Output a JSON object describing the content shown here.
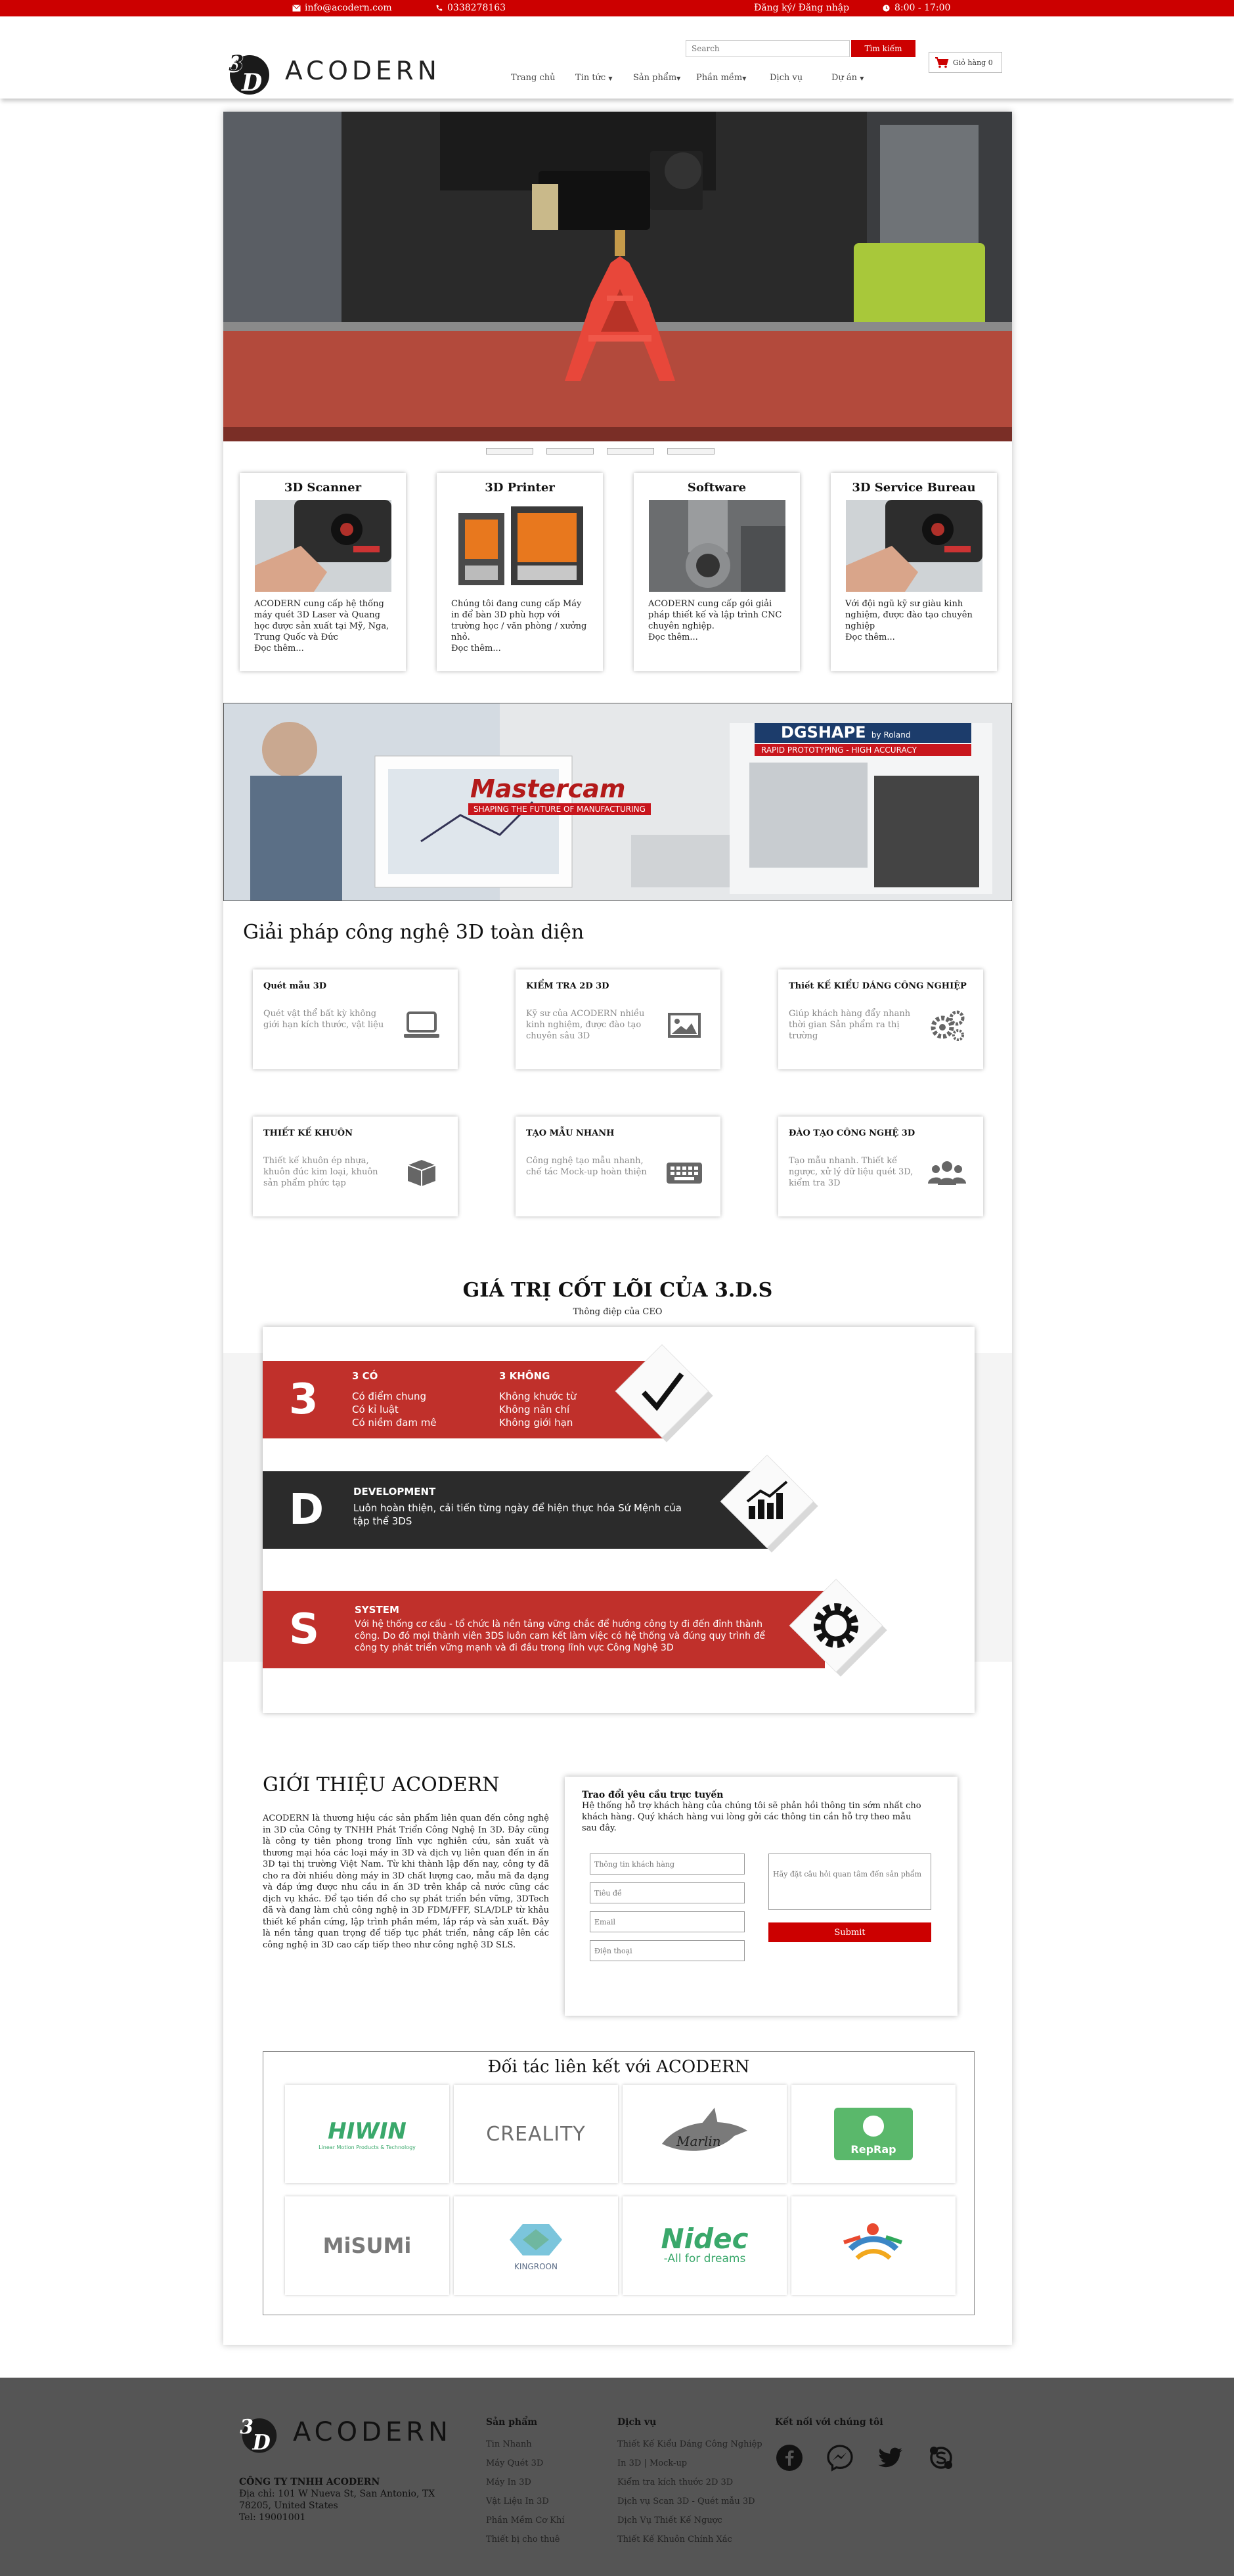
{
  "topbar": {
    "email": "info@acodern.com",
    "phone": "0338278163",
    "auth": "Đăng ký/ Đăng nhập",
    "hours": "8:00 - 17:00"
  },
  "header": {
    "logo_text": "ACODERN",
    "search_placeholder": "Search",
    "search_button": "Tìm kiếm",
    "cart_label": "Giỏ hàng 0",
    "nav": [
      "Trang chủ",
      "Tin tức",
      "Sản phẩm",
      "Phần mềm",
      "Dịch vụ",
      "Dự án"
    ]
  },
  "hero": {
    "slides": 4
  },
  "categories": [
    {
      "title": "3D Scanner",
      "desc": "ACODERN cung cấp hệ thống máy quét 3D Laser và Quang học được sản xuất tại Mỹ, Nga, Trung Quốc và Đức",
      "more": "Đọc thêm..."
    },
    {
      "title": "3D Printer",
      "desc": "Chúng tôi đang cung cấp Máy in để bàn 3D phù hợp với trường học / văn phòng / xưởng nhỏ.",
      "more": "Đọc thêm..."
    },
    {
      "title": "Software",
      "desc": "ACODERN cung cấp gói giải pháp thiết kế và lập trình CNC chuyên nghiệp.",
      "more": "Đọc thêm..."
    },
    {
      "title": "3D Service Bureau",
      "desc": "Với đội ngũ kỹ sư giàu kinh nghiệm, được đào tạo chuyên nghiệp",
      "more": "Đọc thêm..."
    }
  ],
  "banner": {
    "brand_left": "Mastercam",
    "tagline_left": "SHAPING THE FUTURE OF MANUFACTURING",
    "brand_right": "DGSHAPE",
    "by": "by Roland",
    "tagline_right": "RAPID PROTOTYPING - HIGH ACCURACY"
  },
  "solutions": {
    "title": "Giải pháp công nghệ 3D toàn diện",
    "items": [
      {
        "title": "Quét mẫu 3D",
        "desc": "Quét vật thể bất kỳ không giới hạn kích thước, vật liệu",
        "icon": "laptop-icon"
      },
      {
        "title": "KIỂM TRA 2D 3D",
        "desc": "Kỹ sư của ACODERN nhiều kinh nghiệm, được đào tạo chuyên sâu 3D",
        "icon": "image-icon"
      },
      {
        "title": "Thiết KẾ KIỂU DÁNG CÔNG NGHIỆP",
        "desc": "Giúp khách hàng đẩy nhanh thời gian Sản phẩm ra thị trường",
        "icon": "gears-icon"
      },
      {
        "title": "THIẾT KẾ KHUÔN",
        "desc": "Thiết kế khuôn ép nhựa, khuôn đúc kim loại, khuôn sản phẩm phức tạp",
        "icon": "box-icon"
      },
      {
        "title": "TẠO MẪU NHANH",
        "desc": "Công nghệ tạo mẫu nhanh, chế tác Mock-up hoàn thiện",
        "icon": "keyboard-icon"
      },
      {
        "title": "ĐÀO TẠO CÔNG NGHỆ 3D",
        "desc": "Tạo mẫu nhanh. Thiết kế ngược, xử lý dữ liệu quét 3D, kiểm tra 3D",
        "icon": "users-icon"
      }
    ]
  },
  "core_values": {
    "title": "GIÁ TRỊ CỐT LÕI CỦA 3.D.S",
    "subtitle": "Thông điệp của CEO",
    "rows": [
      {
        "letter": "3",
        "heading_a": "3 CÓ",
        "lines_a": [
          "Có điểm chung",
          "Có kỉ luật",
          "Có niềm đam mê"
        ],
        "heading_b": "3 KHÔNG",
        "lines_b": [
          "Không khước từ",
          "Không nản chí",
          "Không giới hạn"
        ],
        "icon": "check-icon"
      },
      {
        "letter": "D",
        "heading_a": "DEVELOPMENT",
        "text": "Luôn hoàn thiện, cải tiến từng ngày để hiện thực hóa Sứ Mệnh của tập thể 3DS",
        "icon": "chart-icon"
      },
      {
        "letter": "S",
        "heading_a": "SYSTEM",
        "text": "Với hệ thống cơ cấu - tổ chức là nền tảng vững chắc để hướng công ty đi đến đỉnh thành công. Do đó mọi thành viên 3DS luôn cam kết làm việc có hệ thống và đúng quy trình để công ty phát triển vững mạnh và đi đầu trong lĩnh vực Công Nghệ 3D",
        "icon": "gear-icon"
      }
    ]
  },
  "intro": {
    "title": "GIỚI THIỆU ACODERN",
    "text": "ACODERN là thương hiệu các sản phẩm liên quan đến công nghệ in 3D của Công ty TNHH Phát Triển Công Nghệ In 3D. Đây cũng là công ty tiên phong trong lĩnh vực nghiên cứu, sản xuất và thương mại hóa các loại máy in 3D và dịch vụ liên quan đến in ấn 3D tại thị trường Việt Nam. Từ khi thành lập đến nay, công ty đã cho ra đời nhiều dòng máy in 3D chất lượng cao, mẫu mã đa dạng và đáp ứng được nhu cầu in ấn 3D trên khắp cả nước cũng các dịch vụ khác. Để tạo tiền đề cho sự phát triển bền vững, 3DTech đã và đang làm chủ công nghệ in 3D FDM/FFF, SLA/DLP từ khâu thiết kế phần cứng, lập trình phần mềm, lắp ráp và sản xuất. Đây là nền tảng quan trọng để tiếp tục phát triển, nâng cấp lên các công nghệ in 3D cao cấp tiếp theo như công nghệ 3D SLS."
  },
  "form": {
    "title": "Trao đổi yêu cầu trực tuyến",
    "desc": "Hệ thống hỗ trợ khách hàng của chúng tôi sẽ phản hồi thông tin sớm nhất cho khách hàng. Quý khách hàng vui lòng gởi các thông tin cần hỗ trợ theo mẫu sau đây.",
    "placeholders": [
      "Thông tin khách hàng",
      "Tiêu đề",
      "Email",
      "Điện thoại"
    ],
    "message_placeholder": "Hãy đặt câu hỏi quan tâm đến sản phẩm",
    "submit": "Submit"
  },
  "partners": {
    "title": "Đối tác liên kết với ACODERN",
    "logos": [
      {
        "name": "HIWIN",
        "sub": "Linear Motion Products & Technology"
      },
      {
        "name": "CREALITY"
      },
      {
        "name": "Marlin"
      },
      {
        "name": "RepRap"
      },
      {
        "name": "MiSUMi"
      },
      {
        "name": "KINGROON"
      },
      {
        "name": "Nidec",
        "sub": "-All for dreams"
      },
      {
        "name": ""
      }
    ]
  },
  "footer": {
    "logo_text": "ACODERN",
    "company": "CÔNG TY TNHH ACODERN",
    "address": "Địa chỉ: 101 W Nueva St, San Antonio, TX 78205, United States",
    "phone": "Tel: 19001001",
    "col_products": {
      "title": "Sản phẩm",
      "links": [
        "Tin Nhanh",
        "Máy Quét 3D",
        "Máy In 3D",
        "Vật Liệu In 3D",
        "Phần Mềm Cơ Khí",
        "Thiết bị cho thuê"
      ]
    },
    "col_services": {
      "title": "Dịch vụ",
      "links": [
        "Thiết Kế Kiểu Dáng Công Nghiệp",
        "In 3D | Mock-up",
        "Kiểm tra kích thước 2D 3D",
        "Dịch vụ Scan 3D - Quét mẫu 3D",
        "Dịch Vụ Thiết Kế Ngược",
        "Thiết Kế Khuôn Chính Xác"
      ]
    },
    "col_social": {
      "title": "Kết nối với chúng tôi"
    }
  }
}
